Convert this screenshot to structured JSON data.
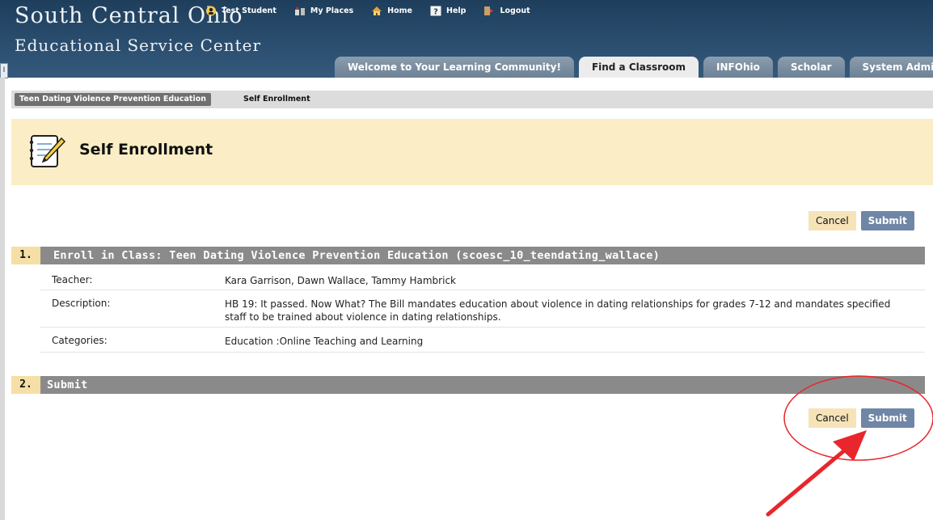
{
  "header": {
    "logo_line1": "South Central Ohio",
    "logo_line2": "Educational Service Center",
    "nav": [
      {
        "label": "Test Student",
        "icon": "user-icon"
      },
      {
        "label": "My Places",
        "icon": "places-icon"
      },
      {
        "label": "Home",
        "icon": "home-icon"
      },
      {
        "label": "Help",
        "icon": "help-icon"
      },
      {
        "label": "Logout",
        "icon": "logout-icon"
      }
    ],
    "handle": "I"
  },
  "tabs": [
    {
      "label": "Welcome to Your Learning Community!",
      "active": false
    },
    {
      "label": "Find a Classroom",
      "active": true
    },
    {
      "label": "INFOhio",
      "active": false
    },
    {
      "label": "Scholar",
      "active": false
    },
    {
      "label": "System Admin",
      "active": false
    }
  ],
  "breadcrumb": {
    "course": "Teen Dating Violence Prevention Education",
    "current": "Self Enrollment"
  },
  "page": {
    "title": "Self Enrollment",
    "title_icon": "notepad-pencil-icon"
  },
  "buttons": {
    "cancel": "Cancel",
    "submit": "Submit"
  },
  "step1": {
    "number": "1.",
    "title": "Enroll in Class: Teen Dating Violence Prevention Education (scoesc_10_teendating_wallace)",
    "rows": [
      {
        "label": "Teacher:",
        "value": "Kara Garrison, Dawn Wallace, Tammy Hambrick"
      },
      {
        "label": "Description:",
        "value": "HB 19: It passed. Now What? The Bill mandates education about violence in dating relationships for grades 7-12 and mandates specified staff to be trained about violence in dating relationships."
      },
      {
        "label": "Categories:",
        "value": "Education :Online Teaching and Learning"
      }
    ]
  },
  "step2": {
    "number": "2.",
    "title": "Submit"
  },
  "colors": {
    "header_bg": "#2c4f70",
    "step_bar": "#8a8a8a",
    "title_band": "#fbeec6",
    "submit_bg": "#6f86a6",
    "annotation_red": "#e8262b"
  }
}
